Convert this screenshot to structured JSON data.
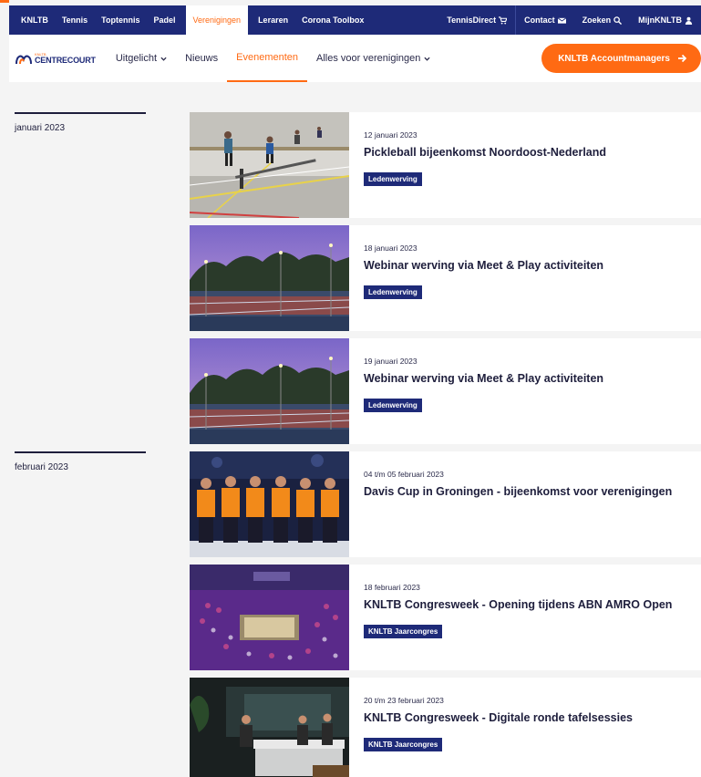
{
  "topnav": {
    "items": [
      "KNLTB",
      "Tennis",
      "Toptennis",
      "Padel",
      "Verenigingen",
      "Leraren",
      "Corona Toolbox"
    ],
    "active_index": 4,
    "right": [
      "TennisDirect",
      "Contact",
      "Zoeken",
      "MijnKNLTB"
    ]
  },
  "subnav": {
    "logo_small": "KNLTB",
    "logo_big": "CENTRECOURT",
    "items": [
      "Uitgelicht",
      "Nieuws",
      "Evenementen",
      "Alles voor verenigingen"
    ],
    "active_index": 2,
    "cta": "KNLTB Accountmanagers"
  },
  "months": [
    "januari 2023",
    "februari 2023"
  ],
  "events": [
    {
      "date": "12 januari 2023",
      "title": "Pickleball bijeenkomst Noordoost-Nederland",
      "tag": "Ledenwerving"
    },
    {
      "date": "18 januari 2023",
      "title": "Webinar werving via Meet & Play activiteiten",
      "tag": "Ledenwerving"
    },
    {
      "date": "19 januari 2023",
      "title": "Webinar werving via Meet & Play activiteiten",
      "tag": "Ledenwerving"
    },
    {
      "date": "04 t/m 05 februari 2023",
      "title": "Davis Cup in Groningen - bijeenkomst voor verenigingen",
      "tag": ""
    },
    {
      "date": "18 februari 2023",
      "title": "KNLTB Congresweek - Opening tijdens ABN AMRO Open",
      "tag": "KNLTB Jaarcongres"
    },
    {
      "date": "20 t/m 23 februari 2023",
      "title": "KNLTB Congresweek - Digitale ronde tafelsessies",
      "tag": "KNLTB Jaarcongres"
    }
  ],
  "colors": {
    "navy": "#1e2a78",
    "orange": "#ff6a13"
  }
}
